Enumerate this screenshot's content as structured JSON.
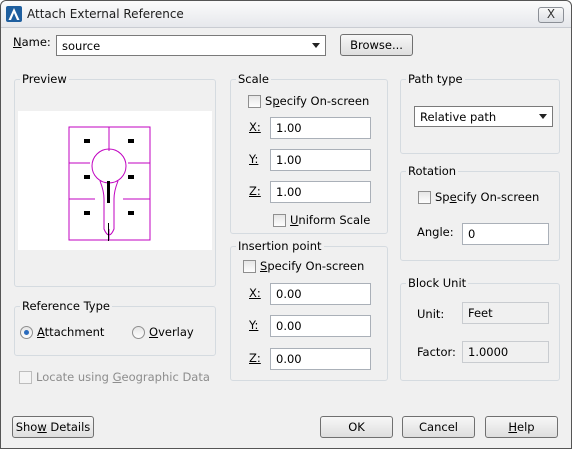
{
  "title": "Attach External Reference",
  "close_label": "X",
  "name": {
    "label": "Name:",
    "underline": "N",
    "rest": "ame:",
    "value": "source",
    "browse_label": "Browse..."
  },
  "preview": {
    "title": "Preview"
  },
  "scale": {
    "title": "Scale",
    "specify_label_pre": "S",
    "specify_label_u": "p",
    "specify_label_post": "ecify On-screen",
    "x_label": "X:",
    "y_label": "Y:",
    "z_label": "Z:",
    "x_value": "1.00",
    "y_value": "1.00",
    "z_value": "1.00",
    "uniform_label_u": "U",
    "uniform_label_post": "niform Scale"
  },
  "insertion": {
    "title": "Insertion point",
    "specify_label_pre": "",
    "specify_label_u": "S",
    "specify_label_post": "pecify On-screen",
    "x_label": "X:",
    "y_label": "Y:",
    "z_label": "Z:",
    "x_value": "0.00",
    "y_value": "0.00",
    "z_value": "0.00"
  },
  "path_type": {
    "title": "Path type",
    "value": "Relative path"
  },
  "rotation": {
    "title": "Rotation",
    "specify_label_pre": "Sp",
    "specify_label_u": "e",
    "specify_label_post": "cify On-screen",
    "angle_label": "Angle:",
    "angle_value": "0"
  },
  "block_unit": {
    "title": "Block Unit",
    "unit_label": "Unit:",
    "unit_value": "Feet",
    "factor_label": "Factor:",
    "factor_value": "1.0000"
  },
  "reference_type": {
    "title": "Reference Type",
    "attachment_u": "A",
    "attachment_rest": "ttachment",
    "overlay_u": "O",
    "overlay_rest": "verlay"
  },
  "geo": {
    "label_pre": "Locate using ",
    "label_u": "G",
    "label_post": "eographic Data"
  },
  "buttons": {
    "show_details_pre": "Sho",
    "show_details_u": "w",
    "show_details_post": " Details",
    "ok": "OK",
    "cancel": "Cancel",
    "help_u": "H",
    "help_rest": "elp"
  },
  "colors": {
    "preview_lines": "#c000c0",
    "accent": "#2a6bbd"
  }
}
